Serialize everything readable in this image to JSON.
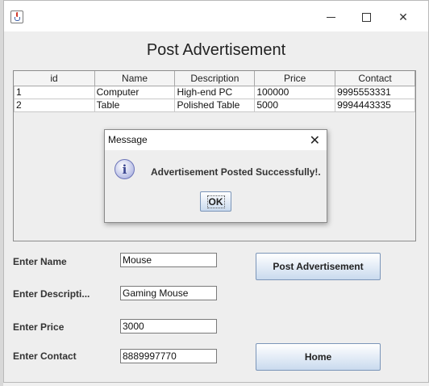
{
  "window": {
    "title": "",
    "close_glyph": "✕",
    "icon": "java-cup-icon"
  },
  "page": {
    "title": "Post Advertisement"
  },
  "table": {
    "columns": [
      "id",
      "Name",
      "Description",
      "Price",
      "Contact"
    ],
    "rows": [
      [
        "1",
        "Computer",
        "High-end PC",
        "100000",
        "9995553331"
      ],
      [
        "2",
        "Table",
        "Polished Table",
        "5000",
        "9994443335"
      ]
    ]
  },
  "form": {
    "name_label": "Enter Name",
    "name_value": "Mouse",
    "description_label": "Enter Descripti...",
    "description_value": "Gaming Mouse",
    "price_label": "Enter Price",
    "price_value": "3000",
    "contact_label": "Enter Contact",
    "contact_value": "8889997770"
  },
  "buttons": {
    "post_label": "Post Advertisement",
    "home_label": "Home"
  },
  "dialog": {
    "title": "Message",
    "close_glyph": "✕",
    "icon_glyph": "i",
    "message": "Advertisement Posted Successfully!.",
    "ok_label": "OK"
  },
  "colors": {
    "button_gradient_top": "#ffffff",
    "button_gradient_bottom": "#c9daee",
    "button_border": "#7b95b8"
  }
}
